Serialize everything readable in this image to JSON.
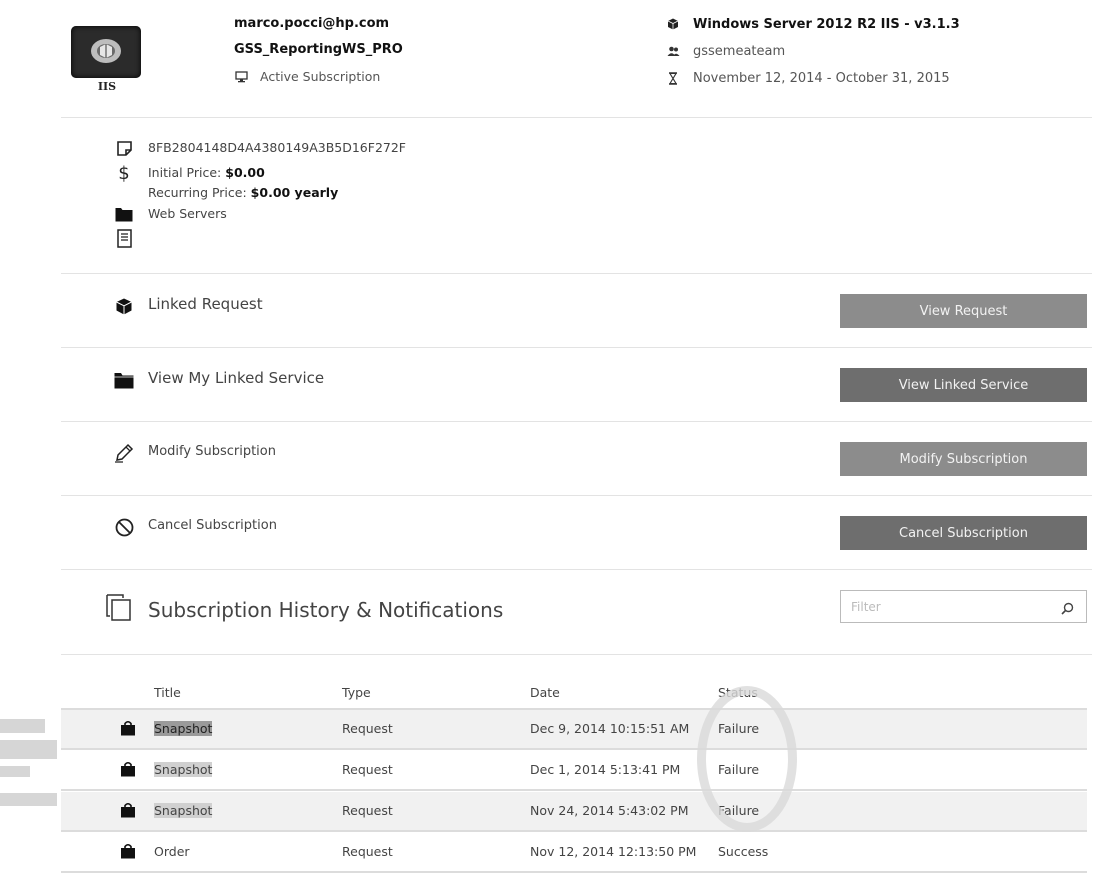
{
  "header": {
    "logo_caption": "IIS",
    "email": "marco.pocci@hp.com",
    "subscription_name": "GSS_ReportingWS_PRO",
    "status": "Active Subscription",
    "product": "Windows Server 2012 R2 IIS - v3.1.3",
    "team": "gssemeateam",
    "period": "November 12, 2014 - October 31, 2015"
  },
  "details": {
    "id": "8FB2804148D4A4380149A3B5D16F272F",
    "initial_price_label": "Initial Price:",
    "initial_price": "$0.00",
    "recurring_price_label": "Recurring Price:",
    "recurring_price": "$0.00 yearly",
    "category": "Web Servers"
  },
  "actions": [
    {
      "label": "Linked Request",
      "button": "View Request",
      "icon": "cube-icon"
    },
    {
      "label": "View My Linked Service",
      "button": "View Linked Service",
      "icon": "folder-icon"
    },
    {
      "label": "Modify Subscription",
      "button": "Modify Subscription",
      "icon": "pencil-icon"
    },
    {
      "label": "Cancel Subscription",
      "button": "Cancel Subscription",
      "icon": "cancel-icon"
    }
  ],
  "history": {
    "title": "Subscription History & Notifications",
    "filter_placeholder": "Filter",
    "columns": [
      "Title",
      "Type",
      "Date",
      "Status"
    ],
    "rows": [
      {
        "title": "Snapshot",
        "type": "Request",
        "date": "Dec 9, 2014 10:15:51 AM",
        "status": "Failure"
      },
      {
        "title": "Snapshot",
        "type": "Request",
        "date": "Dec 1, 2014 5:13:41 PM",
        "status": "Failure"
      },
      {
        "title": "Snapshot",
        "type": "Request",
        "date": "Nov 24, 2014 5:43:02 PM",
        "status": "Failure"
      },
      {
        "title": "Order",
        "type": "Request",
        "date": "Nov 12, 2014 12:13:50 PM",
        "status": "Success"
      }
    ]
  },
  "colors": {
    "button_light": "#8c8c8c",
    "button_dark": "#6e6e6e",
    "divider": "#e3e3e3",
    "row_alt": "#f1f1f1"
  }
}
